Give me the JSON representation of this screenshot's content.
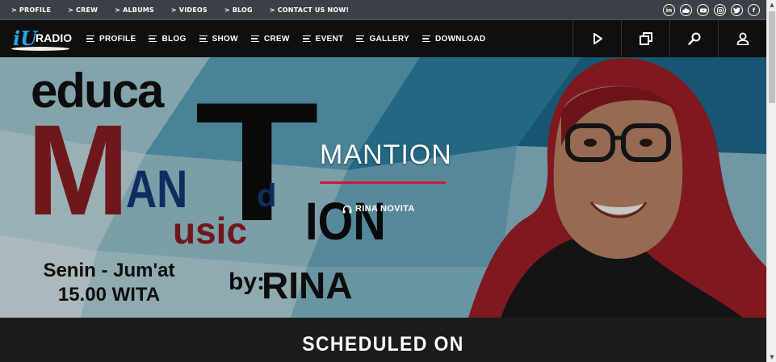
{
  "topbar": {
    "links": [
      {
        "label": "PROFILE"
      },
      {
        "label": "CREW"
      },
      {
        "label": "ALBUMS"
      },
      {
        "label": "VIDEOS"
      },
      {
        "label": "BLOG"
      },
      {
        "label": "CONTACT US NOW!"
      }
    ],
    "socials": [
      "linkedin-icon",
      "cloud-icon",
      "youtube-icon",
      "instagram-icon",
      "twitter-icon",
      "facebook-icon"
    ]
  },
  "navbar": {
    "logo": {
      "iu": "iU",
      "radio": "RADIO"
    },
    "menu": [
      {
        "label": "PROFILE"
      },
      {
        "label": "BLOG"
      },
      {
        "label": "SHOW"
      },
      {
        "label": "CREW"
      },
      {
        "label": "EVENT"
      },
      {
        "label": "GALLERY"
      },
      {
        "label": "DOWNLOAD"
      }
    ],
    "icons": [
      "play-icon",
      "copy-icon",
      "search-icon",
      "user-icon"
    ]
  },
  "hero": {
    "banner": {
      "educa": "educa",
      "big_m": "M",
      "big_t": "T",
      "an": "AN",
      "d": "d",
      "ion": "ION",
      "usic": "usic",
      "schedule_line1": "Senin  -  Jum'at",
      "schedule_line2": "15.00  WITA",
      "by": "by:",
      "host_name": "RINA"
    },
    "show_title": "MANTION",
    "host": "RINA NOVITA"
  },
  "scheduled": {
    "title": "SCHEDULED ON"
  },
  "colors": {
    "accent": "#d0173c",
    "brand_blue": "#2aa3e6",
    "banner_red": "#8e1f25",
    "banner_blue": "#163a7a"
  }
}
